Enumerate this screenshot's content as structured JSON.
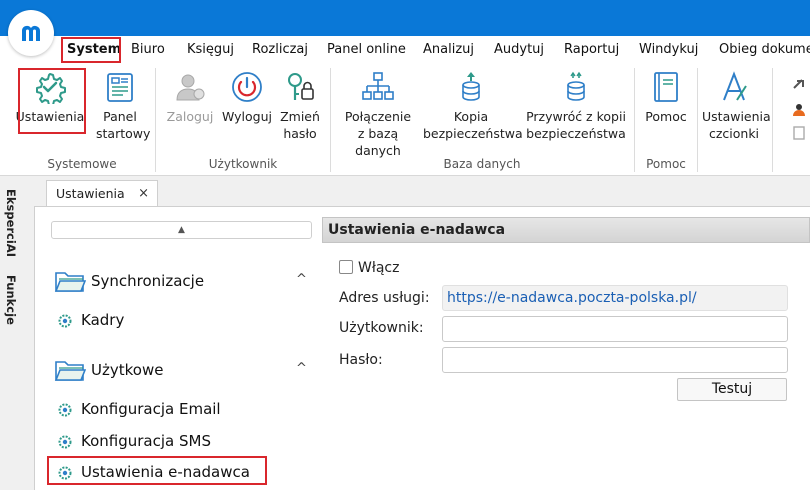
{
  "menu": {
    "items": [
      "System",
      "Biuro",
      "Księguj",
      "Rozliczaj",
      "Panel online",
      "Analizuj",
      "Audytuj",
      "Raportuj",
      "Windykuj",
      "Obieg dokumen"
    ],
    "active": "System"
  },
  "ribbon": {
    "groups": [
      {
        "label": "Systemowe",
        "buttons": [
          {
            "label": "Ustawienia",
            "icon": "gear-check-icon"
          },
          {
            "label": "Panel startowy",
            "icon": "dashboard-panel-icon"
          }
        ]
      },
      {
        "label": "Użytkownik",
        "buttons": [
          {
            "label": "Zaloguj",
            "icon": "user-login-icon",
            "disabled": true
          },
          {
            "label": "Wyloguj",
            "icon": "power-icon"
          },
          {
            "label": "Zmień hasło",
            "icon": "key-lock-icon"
          }
        ]
      },
      {
        "label": "Baza danych",
        "buttons": [
          {
            "label": "Połączenie z bazą danych",
            "icon": "network-icon"
          },
          {
            "label": "Kopia bezpieczeństwa",
            "icon": "database-backup-icon"
          },
          {
            "label": "Przywróć z kopii bezpieczeństwa",
            "icon": "database-restore-icon"
          }
        ]
      },
      {
        "label": "Pomoc",
        "buttons": [
          {
            "label": "Pomoc",
            "icon": "book-icon"
          }
        ]
      },
      {
        "label": "",
        "buttons": [
          {
            "label": "Ustawienia czcionki",
            "icon": "font-icon"
          }
        ]
      }
    ]
  },
  "sidebar": {
    "vertical_tabs": [
      "EksperciAI",
      "Funkcje"
    ]
  },
  "tabs": [
    {
      "label": "Ustawienia",
      "close": "×"
    }
  ],
  "nav": {
    "scroll_up": "▲",
    "groups": [
      {
        "label": "Synchronizacje",
        "items": [
          "Kadry"
        ]
      },
      {
        "label": "Użytkowe",
        "items": [
          "Konfiguracja Email",
          "Konfiguracja SMS",
          "Ustawienia e-nadawca"
        ]
      }
    ],
    "chevron": "^"
  },
  "form": {
    "title": "Ustawienia e-nadawca",
    "enable_label": "Włącz",
    "enable_checked": false,
    "service_label": "Adres usługi:",
    "service_value": "https://e-nadawca.poczta-polska.pl/",
    "user_label": "Użytkownik:",
    "user_value": "",
    "password_label": "Hasło:",
    "password_value": "",
    "test_button": "Testuj"
  },
  "colors": {
    "titlebar": "#0a78d7",
    "highlight": "#d9262c",
    "icon_teal": "#2e9a8a",
    "link": "#1a5fb4"
  }
}
